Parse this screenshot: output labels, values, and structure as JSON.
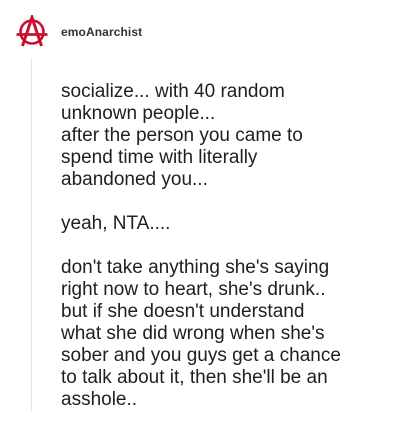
{
  "post": {
    "author": "emoAnarchist",
    "avatar_icon": "anarchy-symbol-icon",
    "accent_color": "#c8102e",
    "paragraphs": [
      {
        "lines": [
          "socialize... with 40 random",
          "unknown people...",
          "after the person you came to",
          "spend time with literally",
          "abandoned you..."
        ]
      },
      {
        "lines": [
          "yeah, NTA...."
        ]
      },
      {
        "lines": [
          "don't take anything she's saying",
          "right now to heart, she's drunk..",
          "but if she doesn't understand",
          "what she did wrong when she's",
          "sober and you guys get a chance",
          "to talk about it, then she'll be an",
          "asshole.."
        ]
      }
    ]
  }
}
